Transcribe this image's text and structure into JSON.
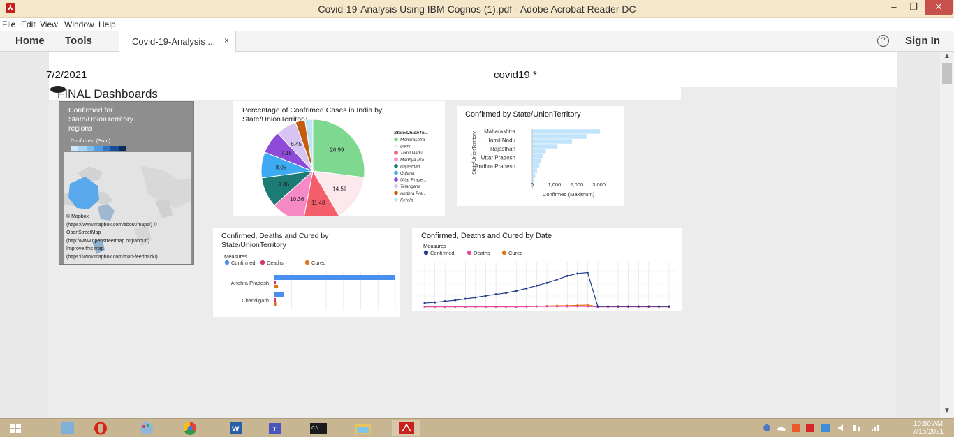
{
  "window": {
    "title": "Covid-19-Analysis Using IBM  Cognos (1).pdf - Adobe Acrobat Reader DC",
    "minimize": "–",
    "maximize": "❐",
    "close": "✕"
  },
  "menu": [
    "File",
    "Edit",
    "View",
    "Window",
    "Help"
  ],
  "toolbar": {
    "home": "Home",
    "tools": "Tools",
    "doc_tab": "Covid-19-Analysis ...",
    "doc_tab_close": "×",
    "help": "?",
    "sign_in": "Sign In"
  },
  "page": {
    "date": "7/2/2021",
    "name": "covid19 *",
    "dashboard_title": "FINAL Dashboards"
  },
  "map_widget": {
    "title": "Confirmed for State/UnionTerritory regions",
    "legend_label": "Confirmed (Sum)",
    "legend_colors": [
      "#cfe8fb",
      "#a8d4f7",
      "#7fbdf0",
      "#4f9de3",
      "#2b76c6",
      "#184d94",
      "#0b2b5c"
    ],
    "credits": [
      "© Mapbox",
      "(https://www.mapbox.com/about/maps/) ©",
      "OpenStreetMap",
      "(http://www.openstreetmap.org/about/)",
      "Improve this map",
      "(https://www.mapbox.com/map-feedback/)"
    ]
  },
  "chart_data": [
    {
      "type": "pie",
      "title": "Percentage of Confrimed Cases in India by State/UnionTerritory",
      "legend_title": "State/UnionTe...",
      "labels": [
        "Maharashtra",
        "Delhi",
        "Tamil Nadu",
        "Madhya Pra...",
        "Rajasthan",
        "Gujarat",
        "Uttar Prade...",
        "Telangana",
        "Andhra Pra...",
        "Kerala"
      ],
      "values": [
        26.99,
        14.59,
        11.48,
        10.36,
        9.46,
        8.05,
        7.15,
        6.45,
        3.0,
        2.47
      ],
      "value_labels": [
        "26.99",
        "14.59",
        "11.48",
        "10.36",
        "9.46",
        "8.05",
        "7.15",
        "6.45",
        "",
        ""
      ],
      "colors": [
        "#7fd88f",
        "#fde8ee",
        "#f45f6b",
        "#f58ac6",
        "#1c7b74",
        "#3daaf2",
        "#8e4ad9",
        "#d8c4f2",
        "#c55c0e",
        "#bfe4f7"
      ]
    },
    {
      "type": "bar",
      "orientation": "horizontal",
      "title": "Confirmed by State/UnionTerritory",
      "ylabel": "State/UnionTerritory",
      "xlabel": "Confirmed (Maximum)",
      "categories": [
        "Maharashtra",
        "Tamil Nadu",
        "Rajasthan",
        "Uttar Pradesh",
        "Andhra Pradesh"
      ],
      "values": [
        3050,
        2450,
        1800,
        1150,
        620,
        500,
        420,
        330,
        230,
        150,
        80,
        40
      ],
      "xticks": [
        "0",
        "1,000",
        "2,000",
        "3,000"
      ],
      "xlim": [
        0,
        3200
      ],
      "color": "#bfe4fb"
    },
    {
      "type": "bar",
      "orientation": "horizontal",
      "title": "Confirmed, Deaths and Cured by State/UnionTerritory",
      "legend_title": "Measures",
      "series": [
        {
          "name": "Confirmed",
          "color": "#4a90f0",
          "values": [
            100,
            8
          ]
        },
        {
          "name": "Deaths",
          "color": "#d6336c",
          "values": [
            1,
            0.5
          ]
        },
        {
          "name": "Cured",
          "color": "#e0741b",
          "values": [
            3,
            1.5
          ]
        }
      ],
      "categories": [
        "Andhra Pradesh",
        "Chandigarh"
      ]
    },
    {
      "type": "line",
      "title": "Confirmed, Deaths and Cured by Date",
      "legend_title": "Measures",
      "series": [
        {
          "name": "Confirmed",
          "color": "#1e3a8a",
          "values": [
            12,
            14,
            17,
            20,
            24,
            28,
            33,
            37,
            41,
            47,
            54,
            62,
            70,
            80,
            90,
            97,
            100,
            2,
            2,
            2,
            2,
            2,
            2,
            2,
            2
          ]
        },
        {
          "name": "Deaths",
          "color": "#e24aa0",
          "values": [
            1,
            1,
            1,
            1,
            1,
            1,
            1,
            1,
            1,
            1,
            1,
            2,
            2,
            2,
            2,
            2,
            2,
            1,
            1,
            1,
            1,
            1,
            1,
            1,
            1
          ]
        },
        {
          "name": "Cured",
          "color": "#e0741b",
          "values": [
            1,
            1,
            1,
            1,
            1,
            1,
            1,
            1,
            1,
            1,
            2,
            2,
            3,
            4,
            4,
            5,
            6,
            1,
            1,
            1,
            1,
            1,
            1,
            1,
            1
          ]
        }
      ],
      "ylim": [
        0,
        105
      ]
    }
  ],
  "taskbar": {
    "time": "10:50 AM",
    "date": "7/15/2021"
  }
}
